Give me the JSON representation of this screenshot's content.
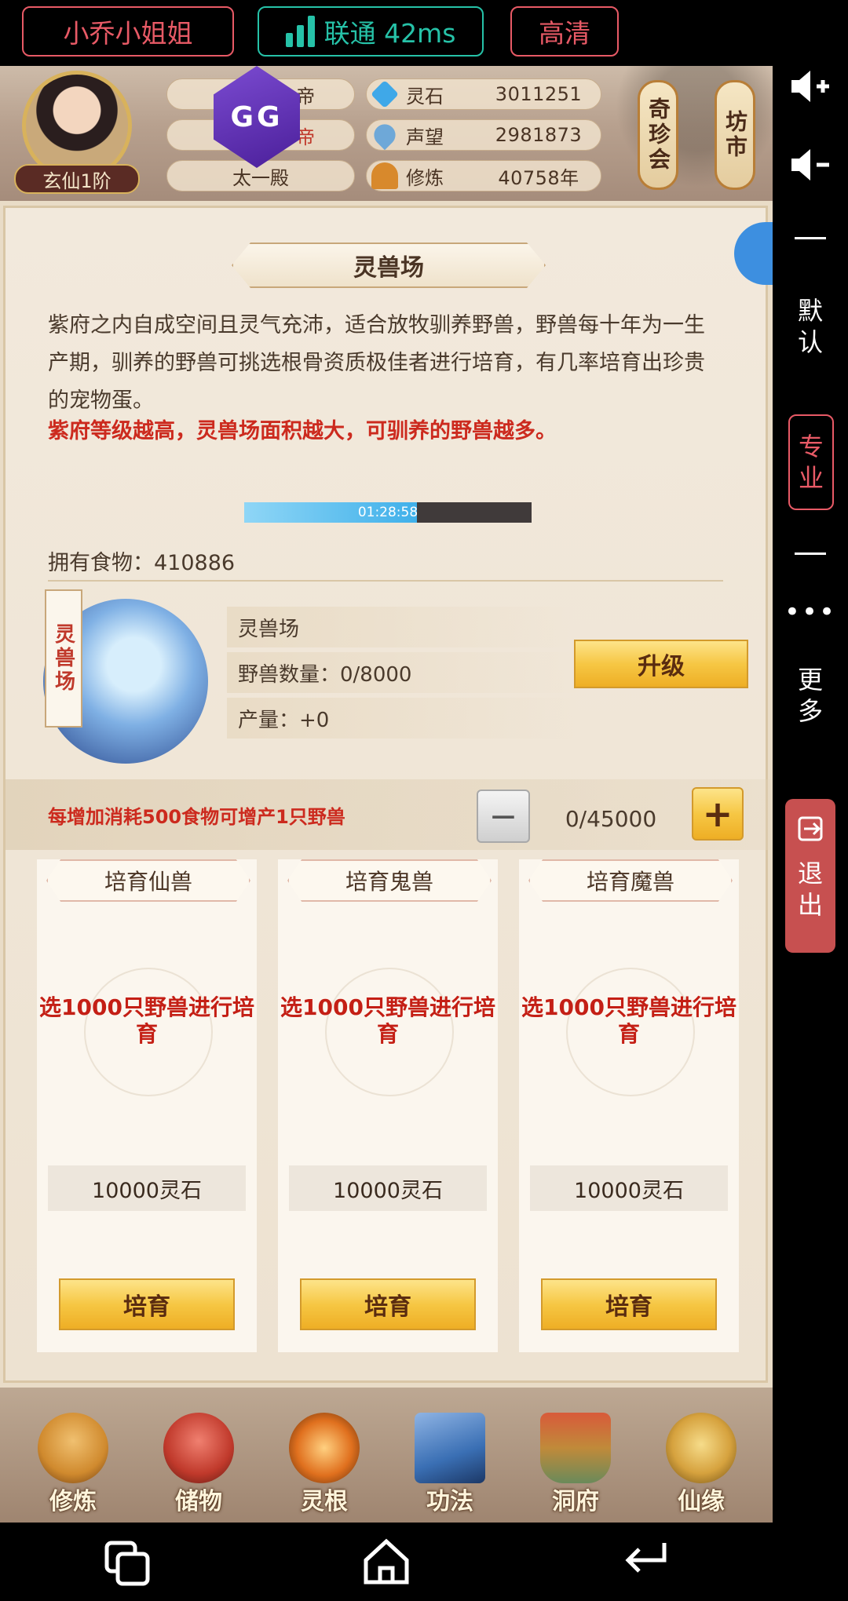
{
  "stream_bar": {
    "nickname": "小乔小姐姐",
    "network": "联通 42ms",
    "quality": "高清"
  },
  "header": {
    "rank": "玄仙1阶",
    "titles": [
      "帝",
      "帝",
      "太一殿"
    ],
    "gg_badge": "GG",
    "resources": [
      {
        "label": "灵石",
        "value": "3011251",
        "icon": "spirit-stone-icon",
        "color": "#3fa8e8"
      },
      {
        "label": "声望",
        "value": "2981873",
        "icon": "prestige-crystal-icon",
        "color": "#6ea8d8"
      },
      {
        "label": "修炼",
        "value": "40758年",
        "icon": "meditation-icon",
        "color": "#d8892c"
      }
    ],
    "scroll_buttons": [
      "奇珍会",
      "坊市"
    ]
  },
  "panel": {
    "title": "灵兽场",
    "description": "紫府之内自成空间且灵气充沛，适合放牧驯养野兽，野兽每十年为一生产期，驯养的野兽可挑选根骨资质极佳者进行培育，有几率培育出珍贵的宠物蛋。",
    "warning": "紫府等级越高，灵兽场面积越大，可驯养的野兽越多。",
    "timer": "01:28:58",
    "food": "拥有食物：410886",
    "facility": {
      "tag": "灵兽场",
      "name": "灵兽场",
      "beasts": "野兽数量：0/8000",
      "output": "产量：+0",
      "upgrade_label": "升级"
    },
    "cost_hint": "每增加消耗500食物可增产1只野兽",
    "stepper": {
      "minus": "−",
      "value": "0/45000",
      "plus": "+"
    },
    "cards": [
      {
        "title": "培育仙兽",
        "pick": "选1000只野兽进行培育",
        "price": "10000灵石",
        "button": "培育"
      },
      {
        "title": "培育鬼兽",
        "pick": "选1000只野兽进行培育",
        "price": "10000灵石",
        "button": "培育"
      },
      {
        "title": "培育魔兽",
        "pick": "选1000只野兽进行培育",
        "price": "10000灵石",
        "button": "培育"
      }
    ]
  },
  "bottom_nav": [
    {
      "label": "修炼",
      "icon": "cultivation-icon",
      "color": "#d08a2e"
    },
    {
      "label": "储物",
      "icon": "storage-bag-icon",
      "color": "#c0392b"
    },
    {
      "label": "灵根",
      "icon": "spirit-root-icon",
      "color": "#e0701e"
    },
    {
      "label": "功法",
      "icon": "technique-book-icon",
      "color": "#3a6fb4"
    },
    {
      "label": "洞府",
      "icon": "cave-mansion-icon",
      "color": "#c08a3a"
    },
    {
      "label": "仙缘",
      "icon": "immortal-fate-icon",
      "color": "#d6a23e"
    }
  ],
  "right_rail": {
    "default_label": "默认",
    "pro_label": "专业",
    "more_label": "更多",
    "exit_label": "退出"
  }
}
